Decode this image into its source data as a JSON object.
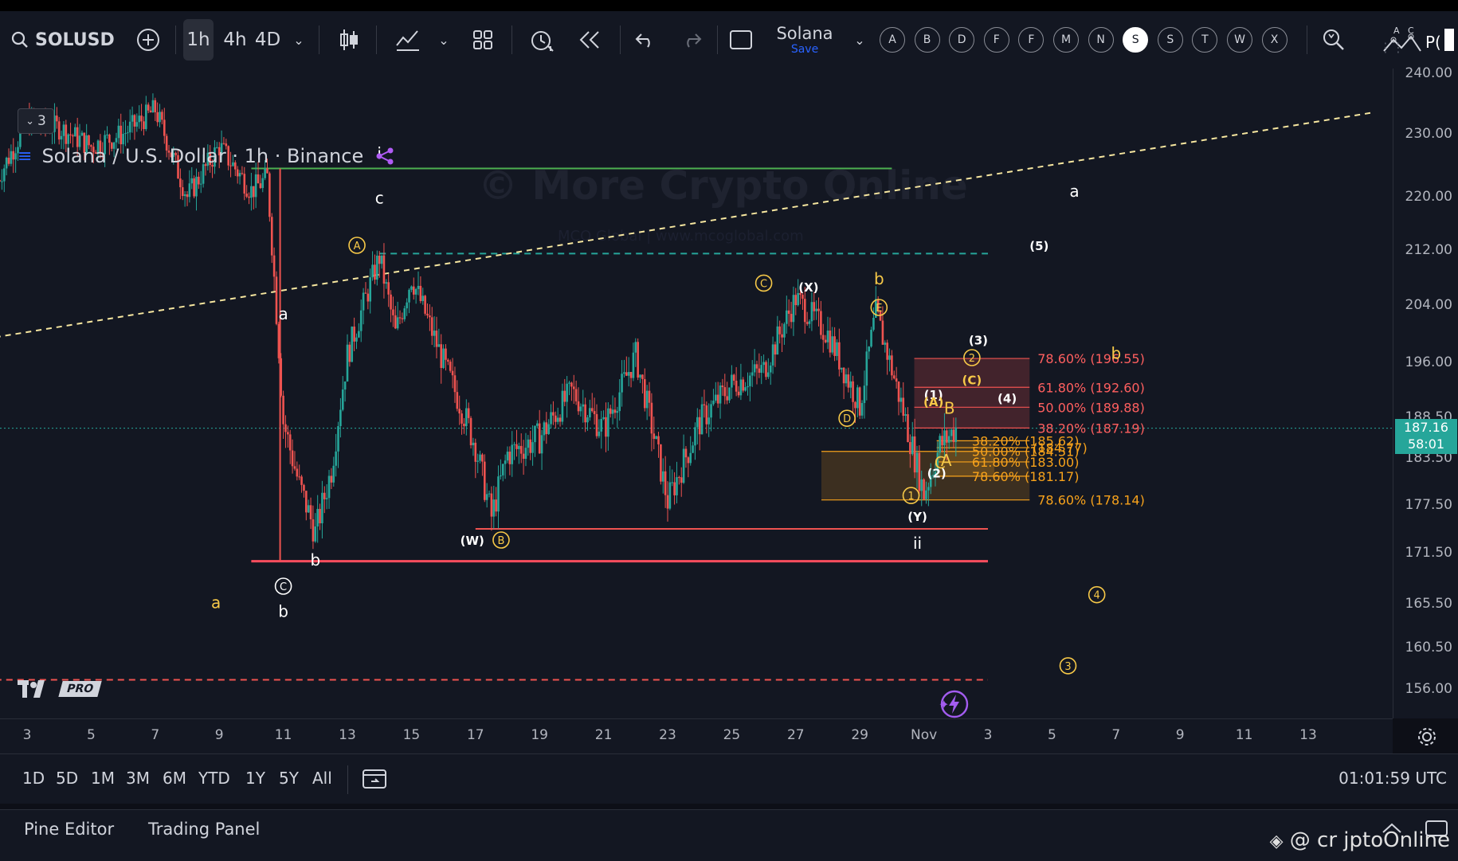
{
  "toolbar": {
    "symbol": "SOLUSD",
    "timeframes": [
      "1h",
      "4h",
      "4D"
    ],
    "active_timeframe": "1h",
    "layout_name": "Solana",
    "layout_save": "Save",
    "drawing_tools": [
      "A",
      "B",
      "D",
      "F",
      "F",
      "M",
      "N",
      "S",
      "S",
      "T",
      "W",
      "X"
    ],
    "selected_tool": "S"
  },
  "legend": {
    "title": "Solana / U.S. Dollar · 1h · Binance",
    "collapse_count": "3"
  },
  "watermark": {
    "main": "© More Crypto Online",
    "sub": "MCO Global  |  www.mcoglobal.com"
  },
  "price_axis": {
    "last_price": "187.16",
    "countdown": "58:01",
    "last_price_color": "#26a69a"
  },
  "ranges": [
    "1D",
    "5D",
    "1M",
    "3M",
    "6M",
    "YTD",
    "1Y",
    "5Y",
    "All"
  ],
  "clock": "01:01:59 UTC",
  "panels": [
    "Pine Editor",
    "Trading Panel"
  ],
  "credit": "@ cr jptoOnline",
  "tv_badge": "PRO",
  "colors": {
    "up": "#26a69a",
    "down": "#ef5350",
    "fib_red": "#ff5f5f",
    "fib_orange": "#f7a21b",
    "green_line": "#4caf50",
    "accent": "#2962ff"
  },
  "chart_data": {
    "type": "candlestick",
    "title": "Solana / U.S. Dollar · 1h · Binance",
    "xlabel": "",
    "ylabel": "",
    "y_ticks": [
      240,
      230,
      220,
      212,
      204,
      196,
      188.5,
      183.5,
      177.5,
      171.5,
      165.5,
      160.5,
      156
    ],
    "y_tick_labels": [
      "240.00",
      "230.00",
      "220.00",
      "212.00",
      "204.00",
      "196.00",
      "188.50",
      "183.50",
      "177.50",
      "171.50",
      "165.50",
      "160.50",
      "156.00"
    ],
    "x_ticks": [
      "3",
      "5",
      "7",
      "9",
      "11",
      "13",
      "15",
      "17",
      "19",
      "21",
      "23",
      "25",
      "27",
      "29",
      "Nov",
      "3",
      "5",
      "7",
      "9",
      "11",
      "13"
    ],
    "last_price": 187.16,
    "price_path": [
      {
        "date": "Oct 2",
        "close": 222
      },
      {
        "date": "Oct 3",
        "close": 232
      },
      {
        "date": "Oct 4",
        "close": 231
      },
      {
        "date": "Oct 5",
        "close": 228
      },
      {
        "date": "Oct 6",
        "close": 230
      },
      {
        "date": "Oct 7",
        "close": 234
      },
      {
        "date": "Oct 8",
        "close": 220
      },
      {
        "date": "Oct 9",
        "close": 228
      },
      {
        "date": "Oct 10",
        "close": 221
      },
      {
        "date": "Oct 10",
        "close": 223
      },
      {
        "date": "Oct 11",
        "close": 188
      },
      {
        "date": "Oct 11",
        "close": 180
      },
      {
        "date": "Oct 12",
        "close": 174
      },
      {
        "date": "Oct 12",
        "close": 182
      },
      {
        "date": "Oct 13",
        "close": 197
      },
      {
        "date": "Oct 14",
        "close": 211
      },
      {
        "date": "Oct 14",
        "close": 200
      },
      {
        "date": "Oct 15",
        "close": 208
      },
      {
        "date": "Oct 16",
        "close": 196
      },
      {
        "date": "Oct 17",
        "close": 185
      },
      {
        "date": "Oct 17",
        "close": 176
      },
      {
        "date": "Oct 18",
        "close": 184
      },
      {
        "date": "Oct 19",
        "close": 186
      },
      {
        "date": "Oct 20",
        "close": 192
      },
      {
        "date": "Oct 21",
        "close": 187
      },
      {
        "date": "Oct 22",
        "close": 197
      },
      {
        "date": "Oct 23",
        "close": 178
      },
      {
        "date": "Oct 24",
        "close": 188
      },
      {
        "date": "Oct 25",
        "close": 193
      },
      {
        "date": "Oct 26",
        "close": 195
      },
      {
        "date": "Oct 27",
        "close": 205
      },
      {
        "date": "Oct 28",
        "close": 200
      },
      {
        "date": "Oct 29",
        "close": 190
      },
      {
        "date": "Oct 29",
        "close": 203
      },
      {
        "date": "Oct 30",
        "close": 195
      },
      {
        "date": "Oct 31",
        "close": 179
      },
      {
        "date": "Oct 31",
        "close": 185
      },
      {
        "date": "Nov 1",
        "close": 187.16
      }
    ],
    "horizontal_lines": [
      {
        "price": 224.5,
        "color": "#4caf50",
        "from": "Oct 10",
        "to": "Oct 30"
      },
      {
        "price": 211.5,
        "color": "#26a69a",
        "style": "dashed",
        "from": "Oct 14",
        "to": "Nov 2"
      },
      {
        "price": 174.5,
        "color": "#ef5350",
        "from": "Oct 17",
        "to": "Nov 2"
      },
      {
        "price": 170.5,
        "color": "#ff4d5e",
        "from": "Oct 10",
        "to": "Nov 2"
      },
      {
        "price": 157,
        "color": "#ef5350",
        "style": "dashed",
        "from": "Oct 2",
        "to": "Nov 2"
      }
    ],
    "trendline": {
      "from": {
        "date": "Oct 2",
        "price": 199.5
      },
      "to": {
        "date": "Nov 14",
        "price": 233.5
      },
      "style": "dashed"
    },
    "fib_levels_red": [
      {
        "label": "78.60% (196.55)",
        "price": 196.55
      },
      {
        "label": "61.80% (192.60)",
        "price": 192.6
      },
      {
        "label": "50.00% (189.88)",
        "price": 189.88
      },
      {
        "label": "38.20% (187.19)",
        "price": 187.19
      }
    ],
    "fib_levels_orange": [
      {
        "label": "38.20% (185.62)",
        "price": 185.62
      },
      {
        "label": "50.00% (184.31)",
        "price": 184.31
      },
      {
        "label": "61.80% (183.00)",
        "price": 183.0
      },
      {
        "label": "(184.77)",
        "price": 184.77
      },
      {
        "label": "78.60% (181.17)",
        "price": 181.17
      },
      {
        "label": "78.60% (178.14)",
        "price": 178.14
      }
    ],
    "wave_labels": [
      {
        "text": "i",
        "date": "Oct 14",
        "price": 226,
        "color": "#ffffff"
      },
      {
        "text": "c",
        "date": "Oct 14",
        "price": 219,
        "color": "#ffffff"
      },
      {
        "text": "A",
        "date": "Oct 13.3",
        "price": 212,
        "color": "#f7c948",
        "circled": true
      },
      {
        "text": "a",
        "date": "Oct 11",
        "price": 202,
        "color": "#ffffff"
      },
      {
        "text": "b",
        "date": "Oct 12",
        "price": 170,
        "color": "#ffffff"
      },
      {
        "text": "C",
        "date": "Oct 11",
        "price": 167,
        "color": "#ffffff",
        "circled": true
      },
      {
        "text": "b",
        "date": "Oct 11",
        "price": 164,
        "color": "#ffffff"
      },
      {
        "text": "a",
        "date": "Oct 8.9",
        "price": 165,
        "color": "#f7c948"
      },
      {
        "text": "(W)",
        "date": "Oct 16.9",
        "price": 172.5,
        "color": "#ffffff"
      },
      {
        "text": "B",
        "date": "Oct 17.8",
        "price": 172.5,
        "color": "#f7c948",
        "circled": true
      },
      {
        "text": "C",
        "date": "Oct 26",
        "price": 206.5,
        "color": "#f7c948",
        "circled": true
      },
      {
        "text": "(X)",
        "date": "Oct 27.4",
        "price": 206,
        "color": "#ffffff"
      },
      {
        "text": "b",
        "date": "Oct 29.6",
        "price": 207,
        "color": "#f7c948"
      },
      {
        "text": "E",
        "date": "Oct 29.6",
        "price": 203,
        "color": "#f7c948",
        "circled": true
      },
      {
        "text": "D",
        "date": "Oct 28.6",
        "price": 187.8,
        "color": "#f7c948",
        "circled": true
      },
      {
        "text": "1",
        "date": "Oct 30.6",
        "price": 178.1,
        "color": "#f7c948",
        "circled": true
      },
      {
        "text": "(Y)",
        "date": "Oct 30.8",
        "price": 175.5,
        "color": "#ffffff"
      },
      {
        "text": "ii",
        "date": "Oct 30.8",
        "price": 172,
        "color": "#ffffff"
      },
      {
        "text": "(1)",
        "date": "Oct 31.3",
        "price": 191,
        "color": "#ffffff"
      },
      {
        "text": "(A)",
        "date": "Oct 31.3",
        "price": 190,
        "color": "#f7c948"
      },
      {
        "text": "B",
        "date": "Oct 31.8",
        "price": 189,
        "color": "#f7c948"
      },
      {
        "text": "A",
        "date": "Oct 31.7",
        "price": 182.5,
        "color": "#f7c948"
      },
      {
        "text": "C",
        "date": "Nov 0.5",
        "price": 182.2,
        "color": "#f7c948"
      },
      {
        "text": "(2)",
        "date": "Nov 0.4",
        "price": 181,
        "color": "#ffffff"
      },
      {
        "text": "(3)",
        "date": "Nov 1.7",
        "price": 198.5,
        "color": "#ffffff"
      },
      {
        "text": "2",
        "date": "Nov 1.5",
        "price": 196,
        "color": "#f7c948",
        "circled": true
      },
      {
        "text": "(C)",
        "date": "Nov 1.5",
        "price": 193,
        "color": "#f7c948"
      },
      {
        "text": "(4)",
        "date": "Nov 2.6",
        "price": 190.5,
        "color": "#ffffff"
      },
      {
        "text": "(5)",
        "date": "Nov 3.6",
        "price": 212,
        "color": "#ffffff"
      },
      {
        "text": "a",
        "date": "Nov 4.7",
        "price": 220,
        "color": "#ffffff"
      },
      {
        "text": "b",
        "date": "Nov 6",
        "price": 196.5,
        "color": "#f7c948"
      },
      {
        "text": "4",
        "date": "Nov 5.4",
        "price": 166,
        "color": "#f7c948",
        "circled": true
      },
      {
        "text": "3",
        "date": "Nov 4.5",
        "price": 158,
        "color": "#f7c948",
        "circled": true
      }
    ]
  }
}
